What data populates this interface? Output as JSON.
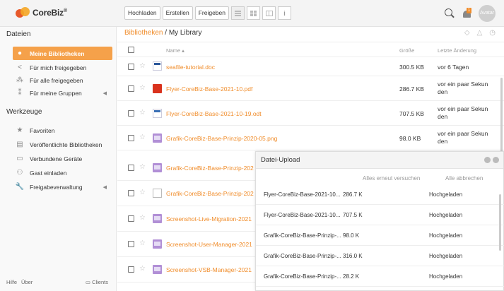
{
  "app": {
    "logo": "CoreBiz",
    "logo_mark": "®"
  },
  "toolbar": {
    "upload": "Hochladen",
    "create": "Erstellen",
    "share": "Freigeben",
    "info_icon": "i"
  },
  "topright": {
    "notification_count": "1",
    "avatar": "Avatar"
  },
  "sidebar": {
    "section_files": "Dateien",
    "files_items": [
      {
        "label": "Meine Bibliotheken",
        "icon": "user-icon",
        "glyph": "●"
      },
      {
        "label": "Für mich freigegeben",
        "icon": "share-icon",
        "glyph": "<"
      },
      {
        "label": "Für alle freigegeben",
        "icon": "group-icon",
        "glyph": "⁂"
      },
      {
        "label": "Für meine Gruppen",
        "icon": "users-icon",
        "glyph": "⁑",
        "caret": "◀"
      }
    ],
    "section_tools": "Werkzeuge",
    "tools_items": [
      {
        "label": "Favoriten",
        "icon": "star-icon",
        "glyph": "★"
      },
      {
        "label": "Veröffentlichte Bibliotheken",
        "icon": "library-icon",
        "glyph": "▤"
      },
      {
        "label": "Verbundene Geräte",
        "icon": "monitor-icon",
        "glyph": "▭"
      },
      {
        "label": "Gast einladen",
        "icon": "invite-user-icon",
        "glyph": "⚇"
      },
      {
        "label": "Freigabeverwaltung",
        "icon": "wrench-icon",
        "glyph": "🔧",
        "caret": "◀"
      }
    ],
    "footer": {
      "help": "Hilfe",
      "about": "Über",
      "clients": "Clients"
    }
  },
  "main": {
    "breadcrumb": {
      "link": "Bibliotheken",
      "sep": " / ",
      "current": "My Library"
    },
    "columns": {
      "name": "Name ▴",
      "size": "Größe",
      "date": "Letzte Änderung"
    },
    "files": [
      {
        "name": "seafile-tutorial.doc",
        "size": "300.5 KB",
        "date": "vor 6 Tagen",
        "type": "doc"
      },
      {
        "name": "Flyer-CoreBiz-Base-2021-10.pdf",
        "size": "286.7 KB",
        "date": "vor ein paar Sekun den",
        "type": "pdf"
      },
      {
        "name": "Flyer-CoreBiz-Base-2021-10-19.odt",
        "size": "707.5 KB",
        "date": "vor ein paar Sekun den",
        "type": "odt"
      },
      {
        "name": "Grafik-CoreBiz-Base-Prinzip-2020-05.png",
        "size": "98.0 KB",
        "date": "vor ein paar Sekun den",
        "type": "png"
      },
      {
        "name": "Grafik-CoreBiz-Base-Prinzip-202",
        "size": "",
        "date": "",
        "type": "png"
      },
      {
        "name": "Grafik-CoreBiz-Base-Prinzip-202",
        "size": "",
        "date": "",
        "type": "blank"
      },
      {
        "name": "Screenshot-Live-Migration-2021",
        "size": "",
        "date": "",
        "type": "png"
      },
      {
        "name": "Screenshot-User-Manager-2021",
        "size": "",
        "date": "",
        "type": "png"
      },
      {
        "name": "Screenshot-VSB-Manager-2021",
        "size": "",
        "date": "",
        "type": "png"
      }
    ]
  },
  "upload": {
    "title": "Datei-Upload",
    "retry_all": "Alles erneut versuchen",
    "cancel_all": "Alle abbrechen",
    "items": [
      {
        "name": "Flyer-CoreBiz-Base-2021-10...",
        "size": "286.7 K",
        "status": "Hochgeladen"
      },
      {
        "name": "Flyer-CoreBiz-Base-2021-10...",
        "size": "707.5 K",
        "status": "Hochgeladen"
      },
      {
        "name": "Grafik-CoreBiz-Base-Prinzip-...",
        "size": "98.0 K",
        "status": "Hochgeladen"
      },
      {
        "name": "Grafik-CoreBiz-Base-Prinzip-...",
        "size": "316.0 K",
        "status": "Hochgeladen"
      },
      {
        "name": "Grafik-CoreBiz-Base-Prinzip-...",
        "size": "28.2 K",
        "status": "Hochgeladen"
      }
    ]
  }
}
